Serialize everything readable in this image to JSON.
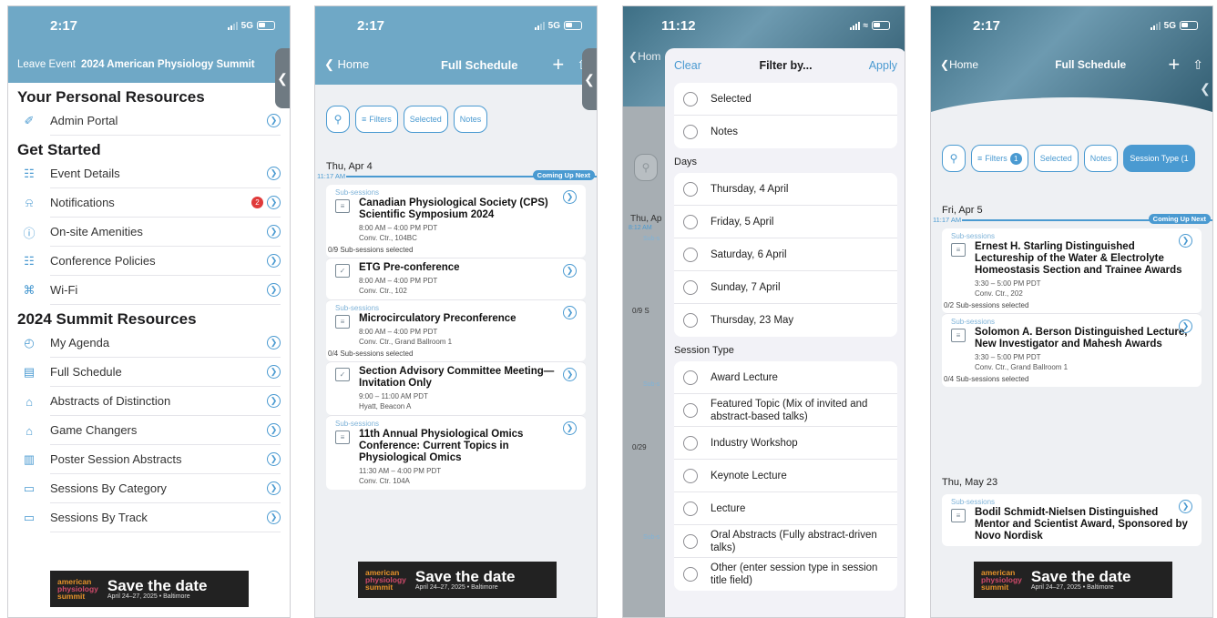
{
  "status": {
    "time_a": "2:17",
    "time_b": "11:12",
    "net": "5G"
  },
  "screen1": {
    "leave": "Leave Event",
    "event_title": "2024 American Physiology Summit",
    "sections": [
      {
        "title": "Your Personal Resources",
        "items": [
          {
            "label": "Admin Portal",
            "icon": "✐"
          }
        ]
      },
      {
        "title": "Get Started",
        "items": [
          {
            "label": "Event Details",
            "icon": "☷"
          },
          {
            "label": "Notifications",
            "icon": "⍾",
            "badge": "2"
          },
          {
            "label": "On-site Amenities",
            "icon": "ⓘ"
          },
          {
            "label": "Conference Policies",
            "icon": "☷"
          },
          {
            "label": "Wi-Fi",
            "icon": "⌘"
          }
        ]
      },
      {
        "title": "2024 Summit Resources",
        "items": [
          {
            "label": "My Agenda",
            "icon": "◴"
          },
          {
            "label": "Full Schedule",
            "icon": "▤"
          },
          {
            "label": "Abstracts of Distinction",
            "icon": "⌂"
          },
          {
            "label": "Game Changers",
            "icon": "⌂"
          },
          {
            "label": "Poster Session Abstracts",
            "icon": "▥"
          },
          {
            "label": "Sessions By Category",
            "icon": "▭"
          },
          {
            "label": "Sessions By Track",
            "icon": "▭"
          }
        ]
      }
    ]
  },
  "banner": {
    "logo1": "american",
    "logo2": "physiology",
    "logo3": "summit",
    "headline": "Save the date",
    "sub": "April 24–27, 2025 • Baltimore"
  },
  "schedule": {
    "back_home": "Home",
    "title": "Full Schedule",
    "chips": {
      "filters": "Filters",
      "selected": "Selected",
      "notes": "Notes",
      "session_type": "Session Type (1",
      "filter_count": "1"
    },
    "coming_up": "Coming Up Next",
    "sub_sessions": "Sub-sessions"
  },
  "screen2": {
    "day": "Thu, Apr 4",
    "now_time": "11:17 AM",
    "cards": [
      {
        "sub": true,
        "icon": "list",
        "title": "Canadian Physiological Society (CPS) Scientific Symposium 2024",
        "time": "8:00 AM – 4:00 PM PDT",
        "loc": "Conv. Ctr., 104BC",
        "selected": "0/9 Sub-sessions selected"
      },
      {
        "sub": false,
        "icon": "check",
        "title": "ETG Pre-conference",
        "time": "8:00 AM – 4:00 PM PDT",
        "loc": "Conv. Ctr., 102",
        "selected": ""
      },
      {
        "sub": true,
        "icon": "list",
        "title": "Microcirculatory Preconference",
        "time": "8:00 AM – 4:00 PM PDT",
        "loc": "Conv. Ctr., Grand Ballroom 1",
        "selected": "0/4 Sub-sessions selected"
      },
      {
        "sub": false,
        "icon": "check",
        "title": "Section Advisory Committee Meeting—Invitation Only",
        "time": "9:00 – 11:00 AM PDT",
        "loc": "Hyatt, Beacon A",
        "selected": ""
      },
      {
        "sub": true,
        "icon": "list",
        "title": "11th Annual Physiological Omics Conference: Current Topics in Physiological Omics",
        "time": "11:30 AM – 4:00 PM PDT",
        "loc": "Conv. Ctr. 104A",
        "selected": ""
      }
    ]
  },
  "screen3": {
    "bg_day": "Thu, Ap",
    "bg_time": "8:12 AM",
    "bg_sel1": "0/9 S",
    "bg_sel2": "0/29",
    "bg_sub": "Sub-s",
    "bg_home": "Hom",
    "clear": "Clear",
    "title": "Filter by...",
    "apply": "Apply",
    "top_options": [
      "Selected",
      "Notes"
    ],
    "days_label": "Days",
    "days": [
      "Thursday, 4 April",
      "Friday, 5 April",
      "Saturday, 6 April",
      "Sunday, 7 April",
      "Thursday, 23 May"
    ],
    "type_label": "Session Type",
    "types": [
      "Award Lecture",
      "Featured Topic (Mix of invited and abstract-based talks)",
      "Industry Workshop",
      "Keynote Lecture",
      "Lecture",
      "Oral Abstracts (Fully abstract-driven talks)",
      "Other (enter session type in session title field)"
    ]
  },
  "screen4": {
    "day1": "Fri, Apr 5",
    "now_time": "11:17 AM",
    "day2": "Thu, May 23",
    "cards1": [
      {
        "title": "Ernest H. Starling Distinguished Lectureship of the Water & Electrolyte Homeostasis Section and Trainee Awards",
        "time": "3:30 – 5:00 PM PDT",
        "loc": "Conv. Ctr., 202",
        "selected": "0/2 Sub-sessions selected"
      },
      {
        "title": "Solomon A. Berson Distinguished Lecture, New Investigator and Mahesh Awards",
        "time": "3:30 – 5:00 PM PDT",
        "loc": "Conv. Ctr., Grand Ballroom 1",
        "selected": "0/4 Sub-sessions selected"
      }
    ],
    "cards2": [
      {
        "title": "Bodil Schmidt-Nielsen Distinguished Mentor and Scientist Award, Sponsored by Novo Nordisk",
        "time": "",
        "loc": "",
        "selected": ""
      }
    ]
  },
  "colors": {
    "accent": "#4a9ad1",
    "header_teal": "#6fa8c6",
    "badge_red": "#e03a3a"
  }
}
